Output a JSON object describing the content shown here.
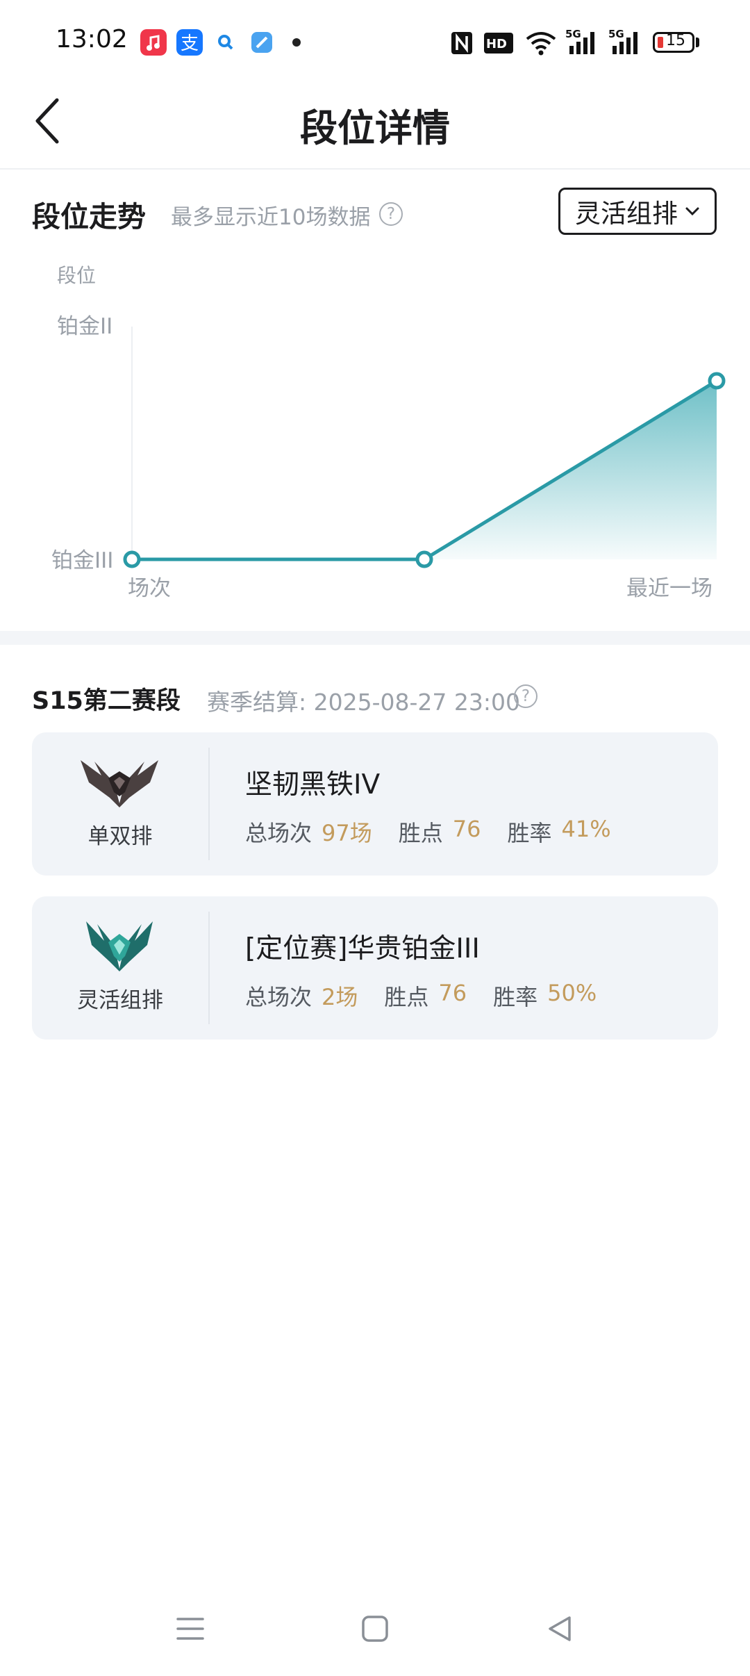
{
  "status_bar": {
    "time": "13:02",
    "apps": [
      "music-app-icon",
      "alipay-app-icon",
      "search-app-icon",
      "browser-app-icon"
    ],
    "right_icons": [
      "nfc-icon",
      "hd-icon",
      "wifi-icon",
      "signal-5g-icon",
      "signal-5g-icon"
    ],
    "battery": "15"
  },
  "header": {
    "title": "段位详情"
  },
  "trend": {
    "title": "段位走势",
    "subtitle": "最多显示近10场数据",
    "help": "?",
    "mode": "灵活组排"
  },
  "chart_data": {
    "type": "area",
    "ylabel": "段位",
    "xlabel": "场次",
    "x_end_label": "最近一场",
    "y_ticks": [
      "铂金III",
      "铂金II"
    ],
    "points": [
      {
        "x": 1,
        "y": "铂金III"
      },
      {
        "x": 2,
        "y": "铂金III"
      },
      {
        "x": 3,
        "y": "铂金II"
      }
    ],
    "colors": {
      "line": "#2a9aa6",
      "area": "#5fb9c1"
    },
    "grid": false
  },
  "season": {
    "title": "S15第二赛段",
    "settle": "赛季结算: 2025-08-27 23:00",
    "help": "?",
    "cards": [
      {
        "queue": "单双排",
        "rank": "坚韧黑铁IV",
        "emblem": "iron-emblem-icon",
        "games_label": "总场次",
        "games_value": "97场",
        "lp_label": "胜点",
        "lp_value": "76",
        "wr_label": "胜率",
        "wr_value": "41%"
      },
      {
        "queue": "灵活组排",
        "rank": "[定位赛]华贵铂金III",
        "emblem": "platinum-emblem-icon",
        "games_label": "总场次",
        "games_value": "2场",
        "lp_label": "胜点",
        "lp_value": "76",
        "wr_label": "胜率",
        "wr_value": "50%"
      }
    ]
  },
  "nav": [
    "menu-icon",
    "home-icon",
    "back-triangle-icon"
  ]
}
